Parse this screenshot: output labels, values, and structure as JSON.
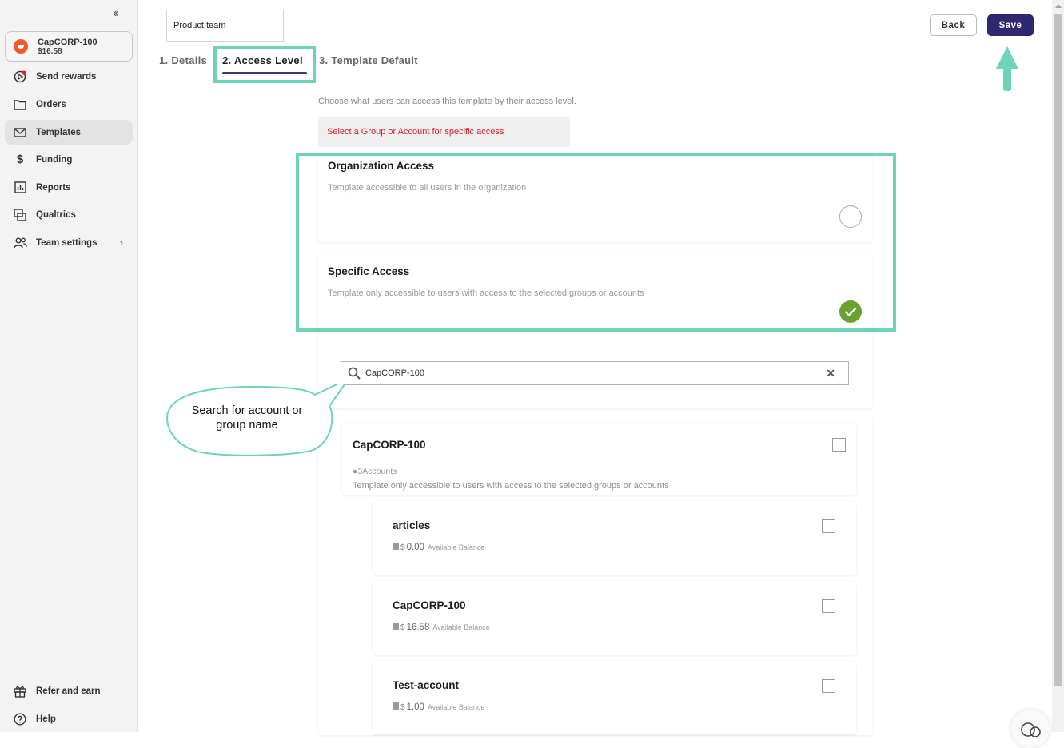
{
  "sidebar": {
    "collapse_icon": "double-chevron-left",
    "account": {
      "name": "CapCORP-100",
      "balance": "$16.58"
    },
    "items": [
      {
        "label": "Send rewards",
        "icon": "send-rewards-icon",
        "has_notification": true
      },
      {
        "label": "Orders",
        "icon": "folder-icon"
      },
      {
        "label": "Templates",
        "icon": "envelope-icon",
        "active": true
      },
      {
        "label": "Funding",
        "icon": "dollar-icon"
      },
      {
        "label": "Reports",
        "icon": "bar-chart-icon"
      },
      {
        "label": "Qualtrics",
        "icon": "qualtrics-icon"
      },
      {
        "label": "Team settings",
        "icon": "team-icon",
        "has_submenu": true
      }
    ],
    "footer": [
      {
        "label": "Refer and earn",
        "icon": "gift-icon"
      },
      {
        "label": "Help",
        "icon": "help-icon"
      }
    ]
  },
  "header": {
    "template_name": "Product team",
    "tabs": [
      {
        "label": "1. Details"
      },
      {
        "label": "2. Access Level",
        "active": true
      },
      {
        "label": "3. Template Default"
      }
    ],
    "back_label": "Back",
    "save_label": "Save"
  },
  "access": {
    "intro": "Choose what users can access this template by their access level.",
    "alert": "Select a Group or Account for specific access",
    "options": [
      {
        "title": "Organization Access",
        "description": "Template accessible to all users in the organization",
        "selected": false
      },
      {
        "title": "Specific Access",
        "description": "Template only accessible to users with access to the selected groups or accounts",
        "selected": true
      }
    ],
    "search": {
      "value": "CapCORP-100",
      "placeholder": ""
    },
    "group": {
      "name": "CapCORP-100",
      "accounts_count": "3Accounts",
      "description": "Template only accessible to users with access to the selected groups or accounts"
    },
    "accounts": [
      {
        "name": "articles",
        "currency": "$",
        "balance": "0.00",
        "balance_label": "Available Balance"
      },
      {
        "name": "CapCORP-100",
        "currency": "$",
        "balance": "16.58",
        "balance_label": "Available Balance"
      },
      {
        "name": "Test-account",
        "currency": "$",
        "balance": "1.00",
        "balance_label": "Available Balance"
      }
    ]
  },
  "annotations": {
    "callout_text": "Search for account or group name",
    "highlight_color": "#6dd3b9"
  },
  "colors": {
    "primary": "#2e2870",
    "tab_underline": "#3d3480",
    "alert_text": "#e11d2a",
    "check_green": "#6aa12f",
    "brand_orange": "#ef5b25"
  }
}
